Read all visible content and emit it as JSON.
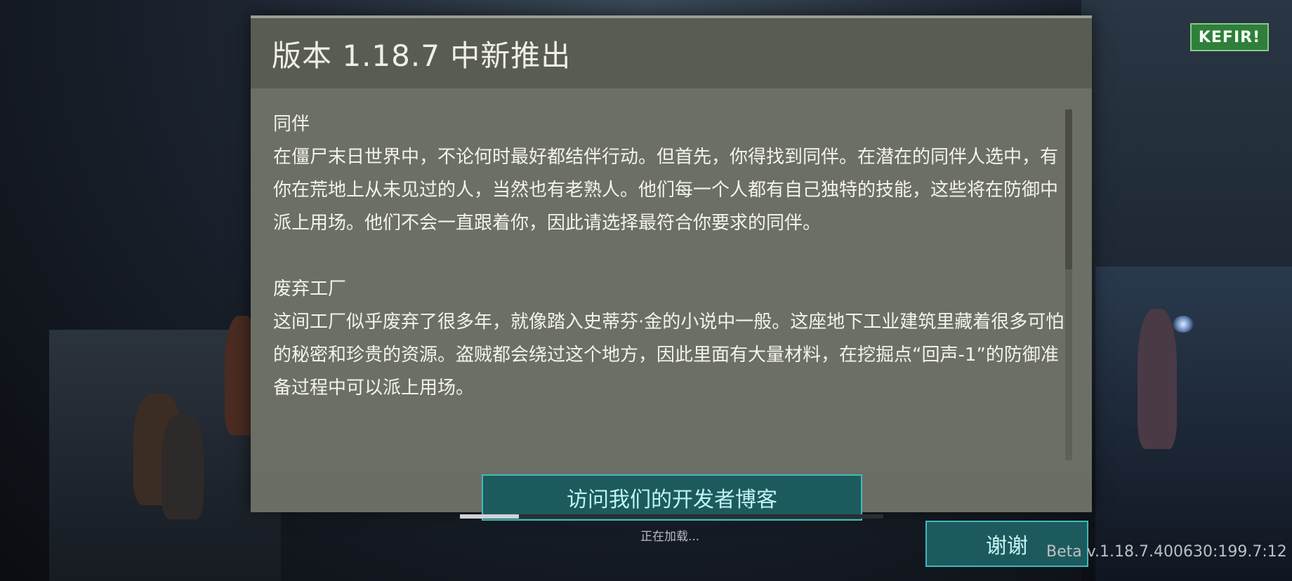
{
  "dialog": {
    "title": "版本 1.18.7 中新推出",
    "sections": [
      {
        "heading": "同伴",
        "text": "在僵尸末日世界中，不论何时最好都结伴行动。但首先，你得找到同伴。在潜在的同伴人选中，有你在荒地上从未见过的人，当然也有老熟人。他们每一个人都有自己独特的技能，这些将在防御中派上用场。他们不会一直跟着你，因此请选择最符合你要求的同伴。"
      },
      {
        "heading": "废弃工厂",
        "text": "这间工厂似乎废弃了很多年，就像踏入史蒂芬·金的小说中一般。这座地下工业建筑里藏着很多可怕的秘密和珍贵的资源。盗贼都会绕过这个地方，因此里面有大量材料，在挖掘点“回声-1”的防御准备过程中可以派上用场。"
      }
    ],
    "blog_button_label": "访问我们的开发者博客"
  },
  "loading": {
    "text": "正在加载...",
    "progress": 0.14
  },
  "thanks_button_label": "谢谢",
  "version_label": "Beta v.1.18.7.400630:199.7:12",
  "logo_text": "KEFIR!",
  "colors": {
    "dialog_bg": "#6b6e64",
    "header_bg": "#595c53",
    "button_bg": "#1d5a5e",
    "button_border": "#3fb9bd",
    "logo_green": "#2f7f3b"
  }
}
